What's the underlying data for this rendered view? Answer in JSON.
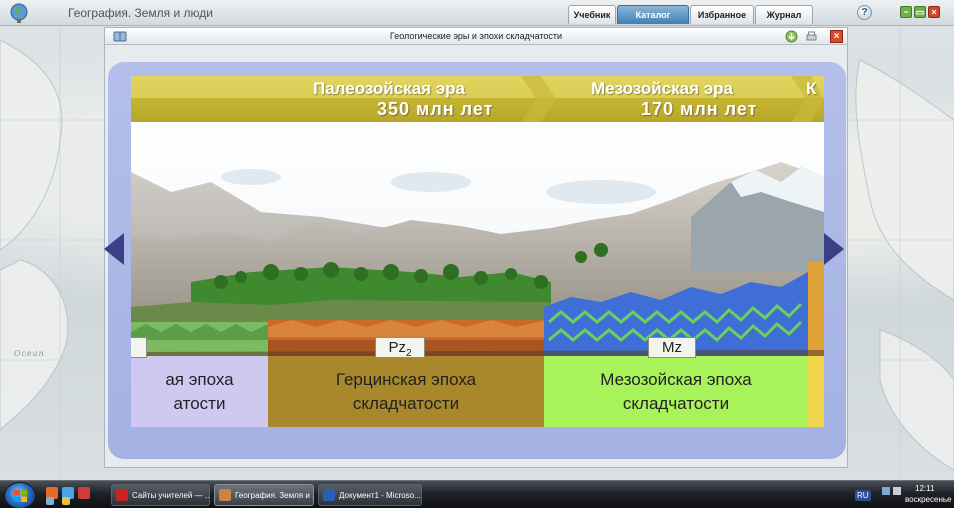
{
  "app": {
    "title": "География. Земля и люди"
  },
  "nav_tabs": [
    {
      "label": "Учебник",
      "active": false
    },
    {
      "label": "Каталог",
      "active": true
    },
    {
      "label": "Избранное",
      "active": false
    },
    {
      "label": "Журнал",
      "active": false
    }
  ],
  "help": {
    "label": "?"
  },
  "window_controls": {
    "minimize": "−",
    "restore": "▭",
    "close": "×"
  },
  "map": {
    "ocean_label": "Ocean"
  },
  "dialog": {
    "title": "Геологические эры и эпохи складчатости",
    "close_label": "×"
  },
  "scene": {
    "eras": [
      {
        "name": "Палеозойская эра",
        "years": "350 млн лет"
      },
      {
        "name": "Мезозойская эра",
        "years": "170 млн лет"
      },
      {
        "name": "К",
        "years": ""
      }
    ],
    "epochs": [
      {
        "code": "",
        "text": "ая эпоха\nатости",
        "color": "#cfc9f2"
      },
      {
        "code": "Pz2",
        "code_main": "Pz",
        "code_sub": "2",
        "text": "Герцинская эпоха\nскладчатости",
        "color": "#a8882a"
      },
      {
        "code": "Mz",
        "text": "Мезозойская эпоха\nскладчатости",
        "color": "#a8f25a"
      }
    ]
  },
  "taskbar": {
    "items": [
      {
        "label": "Сайты учителей — ...",
        "icon": "opera-icon",
        "color": "#cc2222"
      },
      {
        "label": "География. Земля и ...",
        "icon": "app-icon",
        "color": "#c8863a"
      },
      {
        "label": "Документ1 - Microso...",
        "icon": "word-icon",
        "color": "#2b5fb5"
      }
    ],
    "language": "RU",
    "clock_time": "12:11",
    "clock_day": "воскресенье"
  }
}
